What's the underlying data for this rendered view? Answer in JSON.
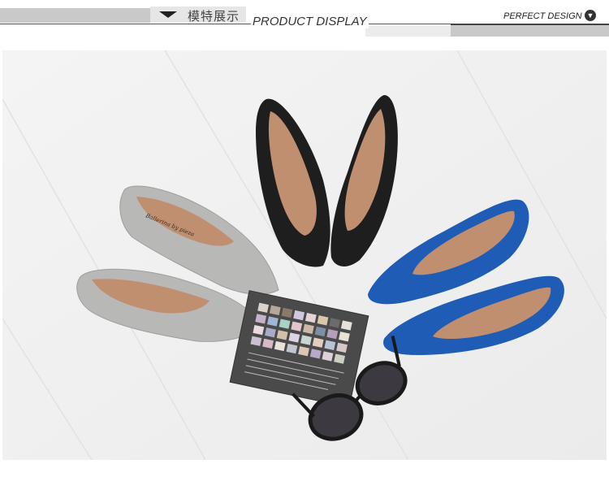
{
  "header": {
    "section_cn": "模特展示",
    "section_en": "PRODUCT DISPLAY",
    "tagline": "PERFECT DESIGN"
  },
  "photo": {
    "shoe_brand_text": "Ballerina by pieza",
    "colors": {
      "background": "#f2f2f2",
      "grey_suede": "#b8b8b6",
      "black_suede": "#1e1e1e",
      "blue_suede": "#1f5cb6",
      "lining": "#c08f70",
      "palette": "#4a4a4a"
    }
  }
}
